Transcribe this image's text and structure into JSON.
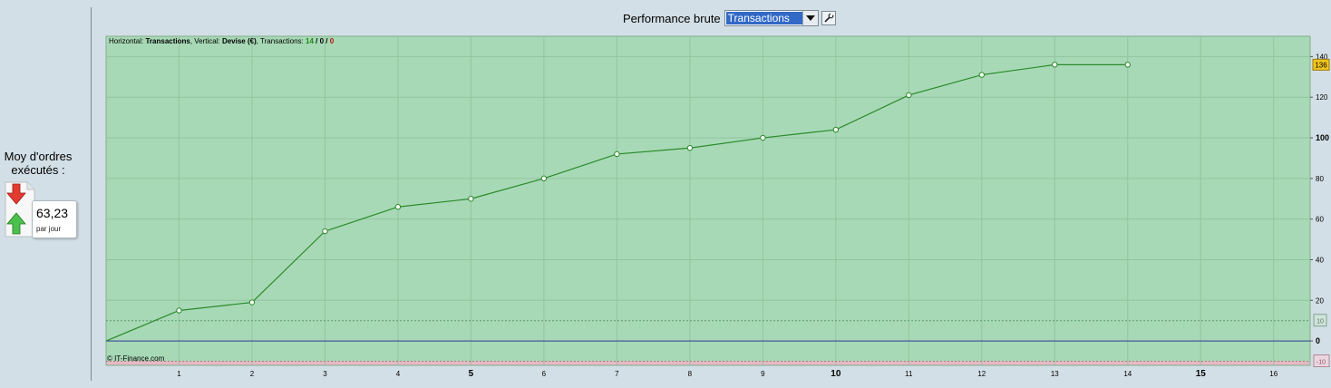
{
  "header": {
    "label": "Performance brute",
    "select_value": "Transactions"
  },
  "info": {
    "horizontal_prefix": "Horizontal: ",
    "horizontal_value": "Transactions",
    "vertical_prefix": ", Vertical: ",
    "vertical_value": "Devise (€)",
    "transactions_prefix": ", Transactions: ",
    "count_total": "14",
    "sep1": " / ",
    "count_mid": "0",
    "sep2": " / ",
    "count_neg": "0"
  },
  "left_panel": {
    "title": "Moy d'ordres exécutés :",
    "value": "63,23",
    "unit": "par jour"
  },
  "copyright": "© IT-Finance.com",
  "colors": {
    "positive_zone": "#a8d9b6",
    "negative_zone": "#e6b9c4",
    "line": "#2a8a2a",
    "zero_line": "#2d3f9a",
    "badge": "#f2c51c"
  },
  "chart_data": {
    "type": "line",
    "x": [
      0,
      1,
      2,
      3,
      4,
      5,
      6,
      7,
      8,
      9,
      10,
      11,
      12,
      13,
      14
    ],
    "y": [
      0,
      15,
      19,
      54,
      66,
      70,
      80,
      92,
      95,
      100,
      104,
      121,
      131,
      136,
      136
    ],
    "xlim": [
      0,
      16.5
    ],
    "ylim": [
      -12,
      150
    ],
    "x_ticks": [
      1,
      2,
      3,
      4,
      5,
      6,
      7,
      8,
      9,
      10,
      11,
      12,
      13,
      14,
      15,
      16
    ],
    "x_bold_ticks": [
      5,
      10,
      15
    ],
    "y_ticks": [
      0,
      20,
      40,
      60,
      80,
      100,
      120,
      140
    ],
    "y_bold_ticks": [
      0,
      100
    ],
    "last_value_badge": "136",
    "upper_threshold": 10,
    "lower_threshold": -10,
    "upper_threshold_label": "10",
    "lower_threshold_label": "-10",
    "grid": true
  }
}
